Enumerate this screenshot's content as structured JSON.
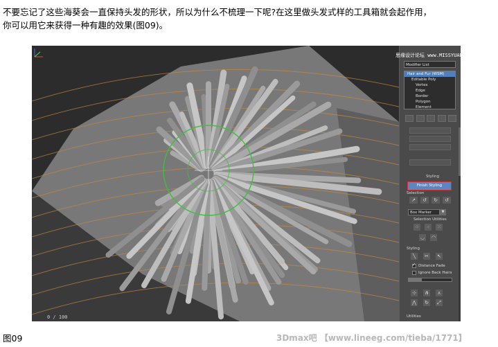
{
  "intro": {
    "line1": "不要忘记了这些海葵会一直保持头发的形状，所以为什么不梳理一下呢?在这里做头发式样的工具箱就会起作用，",
    "line2": "你可以用它来获得一种有趣的效果(图09)。"
  },
  "screenshot": {
    "viewport": {
      "frame_counter": "0 / 100"
    },
    "panel": {
      "watermark": "思缘设计论坛 www.MISSYUAN.COM",
      "modifier_list": "Modifier List",
      "stack": [
        {
          "label": "Hair and Fur (WSM)",
          "selected": true
        },
        {
          "label": "Editable Poly",
          "selected": false
        },
        {
          "label": "Vertex",
          "selected": false
        },
        {
          "label": "Edge",
          "selected": false
        },
        {
          "label": "Border",
          "selected": false
        },
        {
          "label": "Polygon",
          "selected": false
        },
        {
          "label": "Element",
          "selected": false
        }
      ],
      "styling_title": "Styling",
      "finish_styling": "Finish Styling",
      "selection_title": "Selection",
      "dropdown_value": "Box Marker",
      "selection_utilities": "Selection Utilities",
      "styling_sub": "Styling",
      "distance_fade": "Distance Fade",
      "distance_fade_checked": true,
      "ignore_back_hairs": "Ignore Back Hairs",
      "ignore_back_hairs_checked": false,
      "utilities": "Utilities",
      "slider_fraction": 0.3
    }
  },
  "caption": "图09",
  "footer": "3Dmax吧 【www.lineeg.com/tieba/1771】",
  "colors": {
    "selection_blue": "#4e7fbf",
    "highlight_red": "#d03030",
    "hair_guide_orange": "#c8893a",
    "brush_green": "#3fbf3f"
  }
}
